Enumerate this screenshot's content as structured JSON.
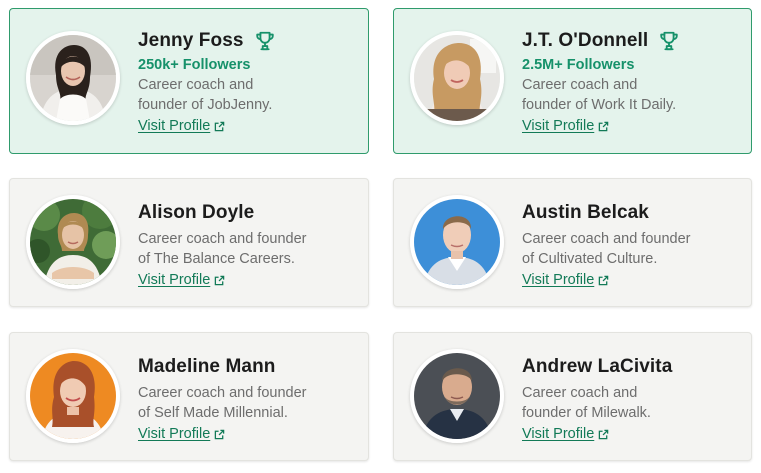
{
  "colors": {
    "accent_green": "#16916a",
    "featured_bg": "#e4f3ec",
    "featured_border": "#2f9b6c",
    "card_bg": "#f4f4f2"
  },
  "cards": [
    {
      "name": "Jenny Foss",
      "featured": true,
      "icon": "trophy-icon",
      "followers": "250k+ Followers",
      "desc_line1": "Career coach and",
      "desc_line2": "founder of JobJenny.",
      "link": "Visit Profile"
    },
    {
      "name": "J.T. O'Donnell",
      "featured": true,
      "icon": "trophy-icon",
      "followers": "2.5M+ Followers",
      "desc_line1": "Career coach and",
      "desc_line2": "founder of Work It Daily.",
      "link": "Visit Profile"
    },
    {
      "name": "Alison Doyle",
      "featured": false,
      "desc_line1": "Career coach and founder",
      "desc_line2": "of The Balance Careers.",
      "link": "Visit Profile"
    },
    {
      "name": "Austin Belcak",
      "featured": false,
      "desc_line1": "Career coach and founder",
      "desc_line2": "of Cultivated Culture.",
      "link": "Visit Profile"
    },
    {
      "name": "Madeline Mann",
      "featured": false,
      "desc_line1": "Career coach and founder",
      "desc_line2": "of Self Made Millennial.",
      "link": "Visit Profile"
    },
    {
      "name": "Andrew LaCivita",
      "featured": false,
      "desc_line1": "Career coach and",
      "desc_line2": "founder of Milewalk.",
      "link": "Visit Profile"
    }
  ]
}
